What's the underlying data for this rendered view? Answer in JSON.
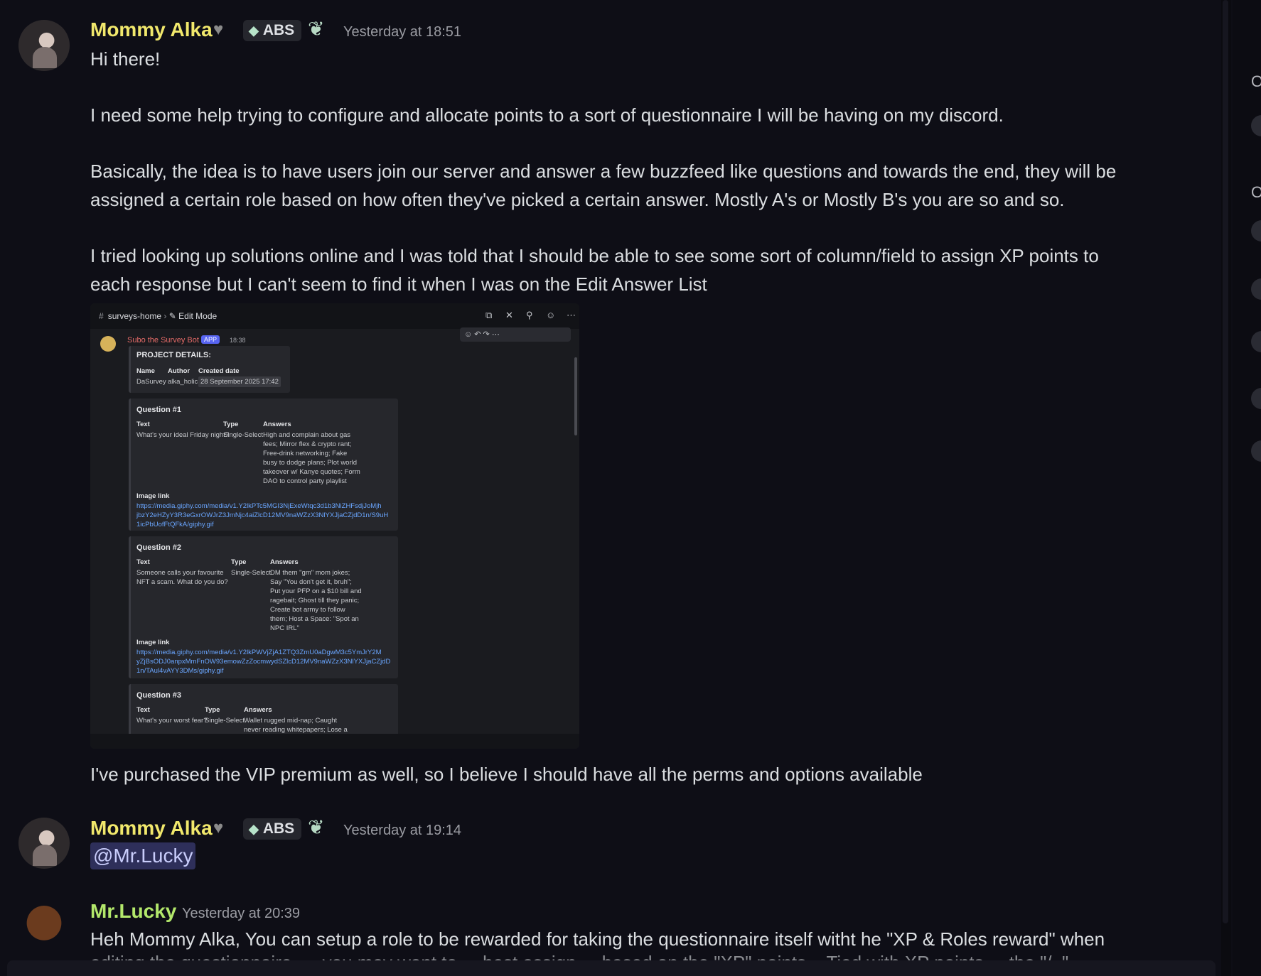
{
  "messages": [
    {
      "author": "Mommy Alka",
      "tag": "ABS",
      "timestamp": "Yesterday at 18:51",
      "paragraphs": [
        "Hi there!",
        "I need some help trying to configure and allocate points to a sort of questionnaire I will be having on my discord.",
        "Basically, the idea is to have users join our server and answer a few buzzfeed like questions and towards the end, they will be\nassigned a certain role based on how often they've picked a certain answer. Mostly A's or Mostly B's you are so and so.",
        "I tried looking up solutions online and I was told that I should be able to see some sort of column/field to assign XP points to\neach response but I can't seem to find it when I was on the Edit Answer List"
      ],
      "after_image": "I've purchased the VIP premium as well, so I believe I should have all the perms and options available"
    },
    {
      "author": "Mommy Alka",
      "tag": "ABS",
      "timestamp": "Yesterday at 19:14",
      "mention": "@Mr.Lucky"
    },
    {
      "author": "Mr.Lucky",
      "timestamp": "Yesterday at 20:39",
      "text": "Heh Mommy Alka,  You can setup a role to be rewarded for taking the questionnaire itself witht he \"XP & Roles reward\" when",
      "text_cut": "editing the questionnaire, ... you may want to ... best assign ... based on the \"XP\" points... Tied with XP points ... the \"/..\""
    }
  ],
  "embed": {
    "channel": "surveys-home",
    "mode": "Edit Mode",
    "bot_name": "Subo the Survey Bot",
    "app_badge": "APP",
    "bot_time": "18:38",
    "project": {
      "title": "PROJECT DETAILS:",
      "headers": [
        "Name",
        "Author",
        "Created date"
      ],
      "values": [
        "DaSurvey",
        "alka_holic",
        "28 September 2025 17:42"
      ]
    },
    "questions": [
      {
        "title": "Question #1",
        "headers": [
          "Text",
          "Type",
          "Answers"
        ],
        "text": "What's your ideal Friday night?",
        "type": "Single-Select",
        "answers": "High and complain about gas\nfees; Mirror flex & crypto rant;\nFree-drink networking; Fake\nbusy to dodge plans; Plot world\ntakeover w/ Kanye quotes; Form\nDAO to control party playlist",
        "image_label": "Image link",
        "image_link": "https://media.giphy.com/media/v1.Y2lkPTc5MGI3NjExeWtqc3d1b3NiZHFsdjJoMjh\njbzY2eHZyY3R3eGxrOWJrZ3JmNjc4aiZlcD12MV9naWZzX3NlYXJjaCZjdD1n/S9uH\n1icPbUofFtQFkA/giphy.gif"
      },
      {
        "title": "Question #2",
        "headers": [
          "Text",
          "Type",
          "Answers"
        ],
        "text": "Someone calls your favourite\nNFT a scam. What do you do?",
        "type": "Single-Select",
        "answers": "DM them \"gm\" mom jokes;\nSay \"You don't get it, bruh\";\nPut your PFP on a $10 bill and\nragebait; Ghost till they panic;\nCreate bot army to follow\nthem; Host a Space: \"Spot an\nNPC IRL\"",
        "image_label": "Image link",
        "image_link": "https://media.giphy.com/media/v1.Y2lkPWVjZjA1ZTQ3ZmU0aDgwM3c5YmJrY2M\nyZjBsODJ0anpxMmFnOW93emowZzZocmwydSZlcD12MV9naWZzX3NlYXJjaCZjdD\n1n/TAul4vAYY3DMs/giphy.gif"
      },
      {
        "title": "Question #3",
        "headers": [
          "Text",
          "Type",
          "Answers"
        ],
        "text": "What's your worst fear?",
        "type": "Single-Select",
        "answers": "Wallet rugged mid-nap; Caught\nnever reading whitepapers; Lose a"
      }
    ]
  },
  "colors": {
    "alka_name": "#f1e86c",
    "lucky_name": "#b3e86b",
    "mention_bg": "#2e2f5a",
    "link": "#6aa6ff",
    "bot_name": "#e46b68",
    "app_badge": "#5865f2"
  },
  "icons": [
    "heart-icon",
    "gem-icon",
    "leaf-icon",
    "hash-icon",
    "pin-icon",
    "members-icon",
    "more-icon"
  ]
}
